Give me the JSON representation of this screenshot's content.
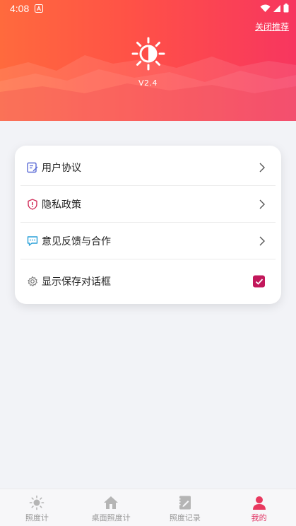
{
  "status_bar": {
    "time": "4:08"
  },
  "header": {
    "close_recommend": "关闭推荐",
    "version": "V2.4"
  },
  "settings": {
    "items": [
      {
        "label": "用户协议",
        "icon": "document-edit-icon",
        "icon_color": "#5b6bd6"
      },
      {
        "label": "隐私政策",
        "icon": "shield-icon",
        "icon_color": "#d2305c"
      },
      {
        "label": "意见反馈与合作",
        "icon": "chat-bubble-icon",
        "icon_color": "#2aa0d8"
      },
      {
        "label": "显示保存对话框",
        "icon": "gear-icon",
        "icon_color": "#777777",
        "checked": true
      }
    ]
  },
  "bottom_nav": {
    "items": [
      {
        "label": "照度计",
        "icon": "sun-icon"
      },
      {
        "label": "桌面照度计",
        "icon": "home-icon"
      },
      {
        "label": "照度记录",
        "icon": "notebook-icon"
      },
      {
        "label": "我的",
        "icon": "person-icon",
        "active": true
      }
    ]
  },
  "colors": {
    "accent": "#e03060",
    "checkbox": "#c2185b",
    "header_start": "#ff6a3d",
    "header_end": "#f7365f"
  }
}
